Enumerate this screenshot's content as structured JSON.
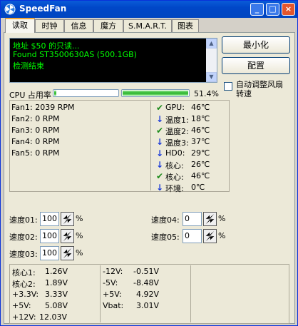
{
  "window": {
    "title": "SpeedFan",
    "minimize_glyph": "_",
    "restore_glyph": "□",
    "close_glyph": "×"
  },
  "tabs": [
    "读取",
    "时钟",
    "信息",
    "魔方",
    "S.M.A.R.T.",
    "图表"
  ],
  "log": {
    "lines": [
      "地址 $50 的只读...",
      "Found ST3500630AS (500.1GB)",
      "检测结束"
    ]
  },
  "buttons": {
    "minimize": "最小化",
    "config": "配置"
  },
  "auto_fan": {
    "label_line1": "自动调整风扇",
    "label_line2": "转速",
    "checked": false
  },
  "cpu": {
    "label": "CPU 占用率",
    "bar1_value": 3,
    "bar2_value": 100,
    "percent": "51.4%"
  },
  "fans": [
    "Fan1: 2039 RPM",
    "Fan2: 0 RPM",
    "Fan3: 0 RPM",
    "Fan4: 0 RPM",
    "Fan5: 0 RPM"
  ],
  "temps": [
    {
      "icon": "check-icon",
      "label": "GPU:",
      "value": "46℃"
    },
    {
      "icon": "down-arrow-icon",
      "label": "温度1:",
      "value": "18℃"
    },
    {
      "icon": "check-icon",
      "label": "温度2:",
      "value": "46℃"
    },
    {
      "icon": "down-arrow-icon",
      "label": "温度3:",
      "value": "37℃"
    },
    {
      "icon": "down-arrow-icon",
      "label": "HD0:",
      "value": "29℃"
    },
    {
      "icon": "down-arrow-icon",
      "label": "核心:",
      "value": "26℃"
    },
    {
      "icon": "check-icon",
      "label": "核心:",
      "value": "46℃"
    },
    {
      "icon": "down-arrow-icon",
      "label": "环境:",
      "value": "0℃"
    }
  ],
  "speeds": [
    {
      "label": "速度01:",
      "value": "100",
      "unit": "%"
    },
    {
      "label": "速度02:",
      "value": "100",
      "unit": "%"
    },
    {
      "label": "速度03:",
      "value": "100",
      "unit": "%"
    },
    {
      "label": "速度04:",
      "value": "0",
      "unit": "%"
    },
    {
      "label": "速度05:",
      "value": "0",
      "unit": "%"
    }
  ],
  "voltages_left": [
    {
      "label": "核心1:",
      "value": "1.26V"
    },
    {
      "label": "核心2:",
      "value": "1.89V"
    },
    {
      "label": "+3.3V:",
      "value": "3.33V"
    },
    {
      "label": "+5V:",
      "value": "5.08V"
    },
    {
      "label": "+12V:",
      "value": "12.03V"
    }
  ],
  "voltages_right": [
    {
      "label": "-12V:",
      "value": "-0.51V"
    },
    {
      "label": "-5V:",
      "value": "-8.48V"
    },
    {
      "label": "+5V:",
      "value": "4.92V"
    },
    {
      "label": "Vbat:",
      "value": "3.01V"
    }
  ],
  "colors": {
    "ok": "#1a8a1a",
    "down": "#1a3ad8",
    "log_text": "#00ff00",
    "titlebar": "#0047c8"
  }
}
